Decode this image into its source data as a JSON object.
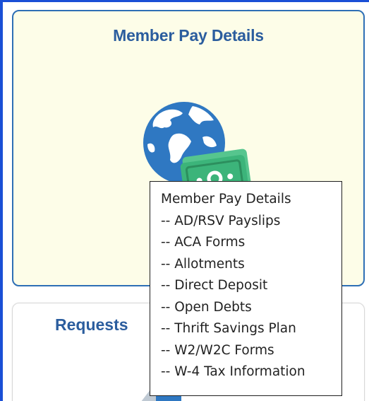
{
  "cards": [
    {
      "title": "Member Pay Details",
      "icon": "globe-money-icon"
    },
    {
      "title": "Requests",
      "icon": "requests-icon"
    }
  ],
  "tooltip": {
    "title": "Member Pay Details",
    "items": [
      "-- AD/RSV Payslips",
      "-- ACA Forms",
      "-- Allotments",
      "-- Direct Deposit",
      "-- Open Debts",
      "-- Thrift Savings Plan",
      "-- W2/W2C Forms",
      "-- W-4 Tax Information"
    ]
  },
  "colors": {
    "card_background": "#fdfde8",
    "card_border": "#2e6fb5",
    "title_text": "#2b5d9e",
    "globe_blue": "#2f78c2",
    "money_green": "#3cb47a",
    "page_border": "#1a4fd6"
  }
}
